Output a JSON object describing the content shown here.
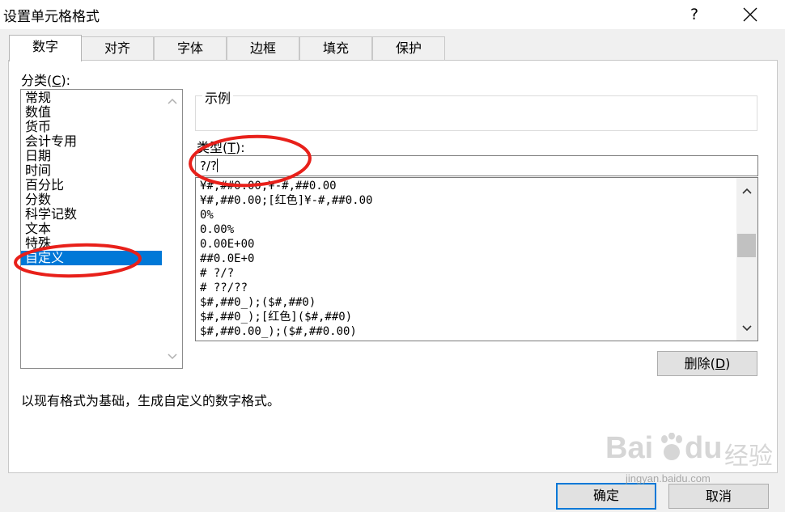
{
  "window": {
    "title": "设置单元格格式",
    "help": "?"
  },
  "tabs": [
    {
      "label": "数字",
      "active": true
    },
    {
      "label": "对齐"
    },
    {
      "label": "字体"
    },
    {
      "label": "边框"
    },
    {
      "label": "填充"
    },
    {
      "label": "保护"
    }
  ],
  "category": {
    "label_prefix": "分类(",
    "label_key": "C",
    "label_suffix": "):",
    "items": [
      "常规",
      "数值",
      "货币",
      "会计专用",
      "日期",
      "时间",
      "百分比",
      "分数",
      "科学记数",
      "文本",
      "特殊",
      "自定义"
    ],
    "selected": "自定义"
  },
  "sample": {
    "label": "示例"
  },
  "type": {
    "label_prefix": "类型(",
    "label_key": "T",
    "label_suffix": "):",
    "value": "?/?"
  },
  "formats": [
    "¥#,##0.00;¥-#,##0.00",
    "¥#,##0.00;[红色]¥-#,##0.00",
    "0%",
    "0.00%",
    "0.00E+00",
    "##0.0E+0",
    "# ?/?",
    "# ??/??",
    "$#,##0_);($#,##0)",
    "$#,##0_);[红色]($#,##0)",
    "$#,##0.00_);($#,##0.00)"
  ],
  "buttons": {
    "delete_prefix": "删除(",
    "delete_key": "D",
    "delete_suffix": ")",
    "ok": "确定",
    "cancel": "取消"
  },
  "description": "以现有格式为基础，生成自定义的数字格式。",
  "watermark": {
    "brand": "Bai",
    "brand2": "du",
    "cn": "经验",
    "url": "jingyan.baidu.com"
  },
  "colors": {
    "selection": "#0078d7",
    "annotation": "#e8201a",
    "primary_border": "#0078d7"
  }
}
